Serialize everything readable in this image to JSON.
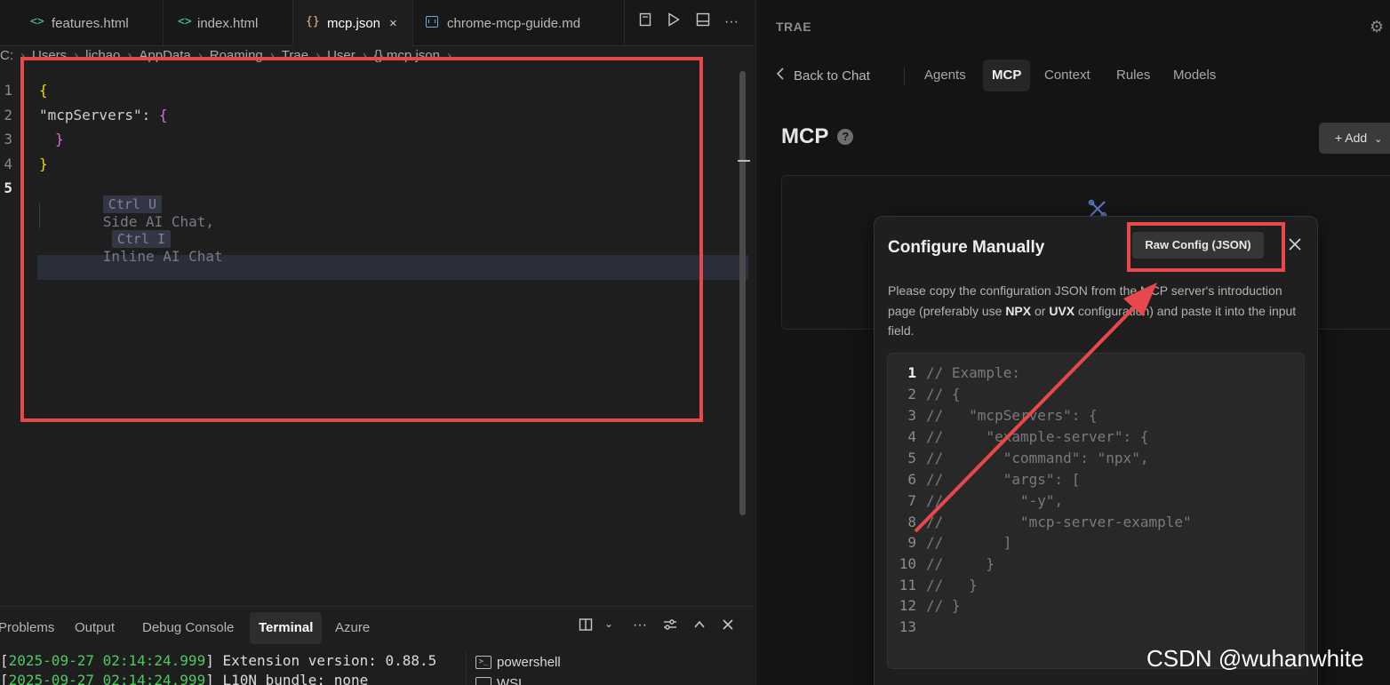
{
  "editor": {
    "tabs": [
      {
        "icon": "<>",
        "label": "features.html"
      },
      {
        "icon": "<>",
        "label": "index.html"
      },
      {
        "icon": "{}",
        "label": "mcp.json",
        "close": "×"
      },
      {
        "icon": "md",
        "label": "chrome-mcp-guide.md"
      }
    ],
    "breadcrumb": [
      "C:",
      "Users",
      "lichao",
      "AppData",
      "Roaming",
      "Trae",
      "User",
      "{} mcp.json",
      "..."
    ],
    "lines": [
      {
        "num": "1",
        "text": "{"
      },
      {
        "num": "2",
        "key": "\"mcpServers\"",
        "colon": ": ",
        "brace": "{"
      },
      {
        "num": "3",
        "text": "}"
      },
      {
        "num": "4",
        "text": "}"
      },
      {
        "num": "5"
      }
    ],
    "hint": {
      "kbd1": "Ctrl U",
      "text1": "Side AI Chat,",
      "kbd2": "Ctrl I",
      "text2": "Inline AI Chat"
    }
  },
  "panel": {
    "tabs": [
      "Problems",
      "Output",
      "Debug Console",
      "Terminal",
      "Azure"
    ],
    "active_tab": "Terminal",
    "terminal_lines": [
      {
        "ts": "2025-09-27 02:14:24.999",
        "msg": "Extension version: 0.88.5"
      },
      {
        "ts": "2025-09-27 02:14:24.999",
        "msg": "L10N bundle: none"
      }
    ],
    "terminals": [
      "powershell",
      "WSL"
    ]
  },
  "trae": {
    "brand": "TRAE",
    "back": "Back to Chat",
    "nav": [
      "Agents",
      "MCP",
      "Context",
      "Rules",
      "Models"
    ],
    "active_nav": "MCP",
    "title": "MCP",
    "help": "?",
    "add": "+ Add",
    "modal": {
      "title": "Configure Manually",
      "raw_button": "Raw Config (JSON)",
      "desc_pre": "Please copy the configuration JSON from the MCP server's introduction page (preferably use ",
      "npx": "NPX",
      "desc_mid": " or ",
      "uvx": "UVX",
      "desc_post": " configuration) and paste it into the input field.",
      "example_lines": [
        {
          "n": "1",
          "t": "// Example:"
        },
        {
          "n": "2",
          "t": "// {"
        },
        {
          "n": "3",
          "t": "//   \"mcpServers\": {"
        },
        {
          "n": "4",
          "t": "//     \"example-server\": {"
        },
        {
          "n": "5",
          "t": "//       \"command\": \"npx\","
        },
        {
          "n": "6",
          "t": "//       \"args\": ["
        },
        {
          "n": "7",
          "t": "//         \"-y\","
        },
        {
          "n": "8",
          "t": "//         \"mcp-server-example\""
        },
        {
          "n": "9",
          "t": "//       ]"
        },
        {
          "n": "10",
          "t": "//     }"
        },
        {
          "n": "11",
          "t": "//   }"
        },
        {
          "n": "12",
          "t": "// }"
        },
        {
          "n": "13",
          "t": ""
        }
      ]
    }
  },
  "watermark": "CSDN @wuhanwhite",
  "colors": {
    "annotation_red": "#e8484b",
    "accent_blue": "#5b7cc7"
  }
}
